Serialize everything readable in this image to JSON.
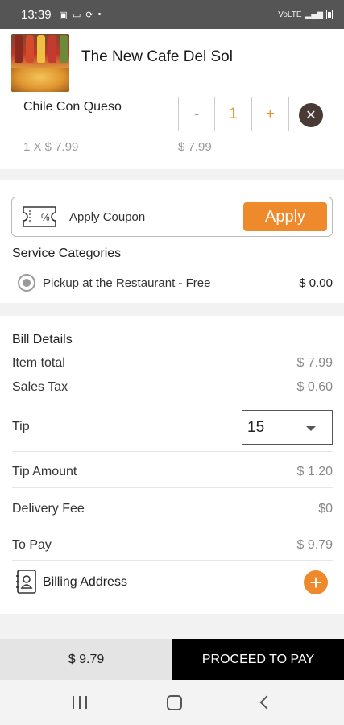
{
  "status_bar": {
    "time": "13:39",
    "signal_text": "VoLTE"
  },
  "cart": {
    "restaurant_name": "The New Cafe Del Sol",
    "item": {
      "name": "Chile Con Queso",
      "unit_price_text": "1 X $ 7.99",
      "line_total": "$ 7.99",
      "quantity": "1",
      "minus_label": "-",
      "plus_label": "+"
    }
  },
  "coupon": {
    "label": "Apply Coupon",
    "button": "Apply"
  },
  "service": {
    "title": "Service Categories",
    "option_label": "Pickup at the Restaurant - Free",
    "option_price": "$ 0.00"
  },
  "bill": {
    "title": "Bill Details",
    "item_total_label": "Item total",
    "item_total": "$ 7.99",
    "sales_tax_label": "Sales Tax",
    "sales_tax": "$ 0.60",
    "tip_label": "Tip",
    "tip_value": "15",
    "tip_amount_label": "Tip Amount",
    "tip_amount": "$ 1.20",
    "delivery_fee_label": "Delivery Fee",
    "delivery_fee": "$0",
    "to_pay_label": "To Pay",
    "to_pay": "$ 9.79",
    "billing_address_label": "Billing Address"
  },
  "footer": {
    "total": "$ 9.79",
    "proceed_label": "PROCEED TO PAY"
  },
  "colors": {
    "accent": "#ee8a2c",
    "dark": "#000000"
  }
}
